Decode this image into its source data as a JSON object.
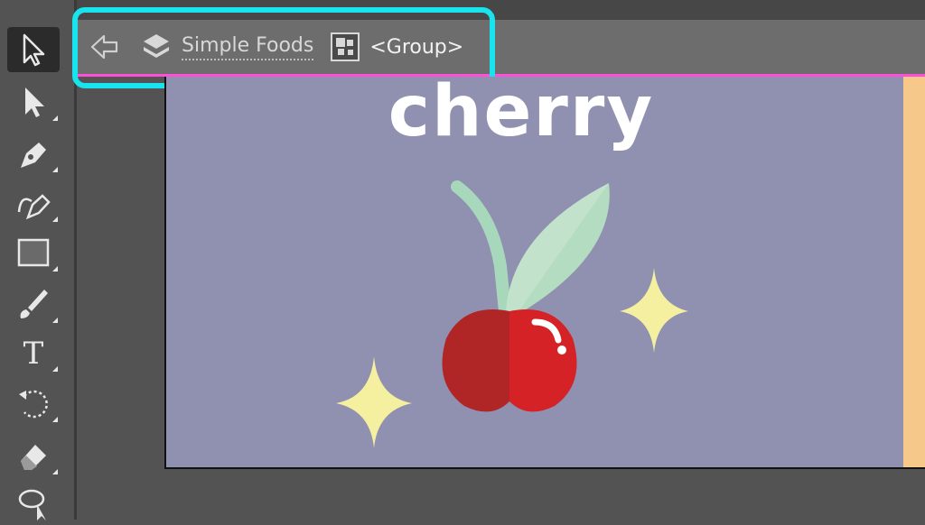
{
  "toolbar": {
    "tools": [
      {
        "name": "selection-tool",
        "icon": "arrow-outline-icon",
        "selected": true
      },
      {
        "name": "direct-selection-tool",
        "icon": "arrow-solid-icon"
      },
      {
        "name": "pen-tool",
        "icon": "pen-icon"
      },
      {
        "name": "curvature-tool",
        "icon": "curvature-pen-icon"
      },
      {
        "name": "rectangle-tool",
        "icon": "rectangle-icon"
      },
      {
        "name": "paintbrush-tool",
        "icon": "brush-icon"
      },
      {
        "name": "type-tool",
        "icon": "type-icon"
      },
      {
        "name": "rotate-tool",
        "icon": "rotate-icon"
      },
      {
        "name": "eraser-tool",
        "icon": "eraser-icon"
      },
      {
        "name": "lasso-tool",
        "icon": "lasso-icon"
      }
    ],
    "type_glyph": "T"
  },
  "isolation_bar": {
    "layer_name": "Simple Foods",
    "group_name": "<Group>",
    "border_color": "#ff4fd8"
  },
  "highlight_color": "#19e3ec",
  "artboard": {
    "title": "cherry",
    "background": "#9090b0",
    "colors": {
      "cherry_dark": "#b02626",
      "cherry_light": "#d42226",
      "leaf": "#b4dcc0",
      "stem": "#a8d8bc",
      "sparkle": "#f5f0a0",
      "side_panel": "#f6c98a"
    }
  }
}
